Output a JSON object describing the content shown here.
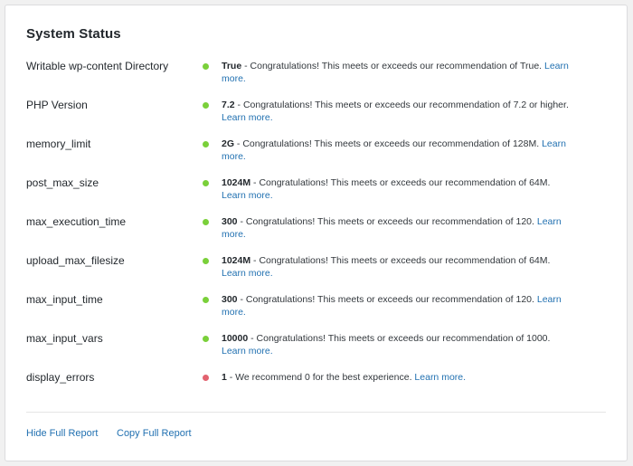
{
  "panel": {
    "title": "System Status",
    "learn_more": "Learn more.",
    "rows": [
      {
        "label": "Writable wp-content Directory",
        "value": "True",
        "message": " - Congratulations! This meets or exceeds our recommendation of True.",
        "status": "ok"
      },
      {
        "label": "PHP Version",
        "value": "7.2",
        "message": " - Congratulations! This meets or exceeds our recommendation of 7.2 or higher.",
        "status": "ok"
      },
      {
        "label": "memory_limit",
        "value": "2G",
        "message": " - Congratulations! This meets or exceeds our recommendation of 128M.",
        "status": "ok"
      },
      {
        "label": "post_max_size",
        "value": "1024M",
        "message": " - Congratulations! This meets or exceeds our recommendation of 64M.",
        "status": "ok"
      },
      {
        "label": "max_execution_time",
        "value": "300",
        "message": " - Congratulations! This meets or exceeds our recommendation of 120.",
        "status": "ok"
      },
      {
        "label": "upload_max_filesize",
        "value": "1024M",
        "message": " - Congratulations! This meets or exceeds our recommendation of 64M.",
        "status": "ok"
      },
      {
        "label": "max_input_time",
        "value": "300",
        "message": " - Congratulations! This meets or exceeds our recommendation of 120.",
        "status": "ok"
      },
      {
        "label": "max_input_vars",
        "value": "10000",
        "message": " - Congratulations! This meets or exceeds our recommendation of 1000.",
        "status": "ok"
      },
      {
        "label": "display_errors",
        "value": "1",
        "message": " - We recommend 0 for the best experience.",
        "status": "warning"
      }
    ],
    "footer": {
      "hide_label": "Hide Full Report",
      "copy_label": "Copy Full Report"
    }
  },
  "colors": {
    "ok": "#7ad03a",
    "warning": "#e2626f",
    "link": "#2271b1"
  }
}
